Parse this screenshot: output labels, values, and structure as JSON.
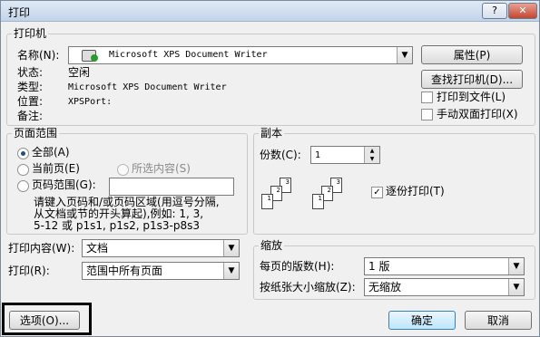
{
  "window": {
    "title": "打印",
    "help": "?",
    "close": "✕"
  },
  "printer": {
    "group_label": "打印机",
    "name_label": "名称(N):",
    "name_value": "Microsoft XPS Document Writer",
    "properties_button": "属性(P)",
    "find_button": "查找打印机(D)...",
    "status_label": "状态:",
    "status_value": "空闲",
    "type_label": "类型:",
    "type_value": "Microsoft XPS Document Writer",
    "where_label": "位置:",
    "where_value": "XPSPort:",
    "comment_label": "备注:",
    "print_to_file": "打印到文件(L)",
    "manual_duplex": "手动双面打印(X)"
  },
  "range": {
    "group_label": "页面范围",
    "all": "全部(A)",
    "current": "当前页(E)",
    "selection": "所选内容(S)",
    "pages": "页码范围(G):",
    "pages_value": "",
    "hint1": "请键入页码和/或页码区域(用逗号分隔,",
    "hint2": "从文档或节的开头算起),例如: 1, 3,",
    "hint3": "5-12 或 p1s1, p1s2, p1s3-p8s3"
  },
  "copies": {
    "group_label": "副本",
    "count_label": "份数(C):",
    "count_value": "1",
    "collate": "逐份打印(T)",
    "collate_checked": true
  },
  "print_what": {
    "label": "打印内容(W):",
    "value": "文档"
  },
  "print_which": {
    "label": "打印(R):",
    "value": "范围中所有页面"
  },
  "zoom": {
    "group_label": "缩放",
    "pps_label": "每页的版数(H):",
    "pps_value": "1 版",
    "scale_label": "按纸张大小缩放(Z):",
    "scale_value": "无缩放"
  },
  "footer": {
    "options": "选项(O)...",
    "ok": "确定",
    "cancel": "取消"
  },
  "icons": {
    "dropdown": "▼",
    "check": "✓",
    "up": "▲",
    "down": "▼"
  }
}
